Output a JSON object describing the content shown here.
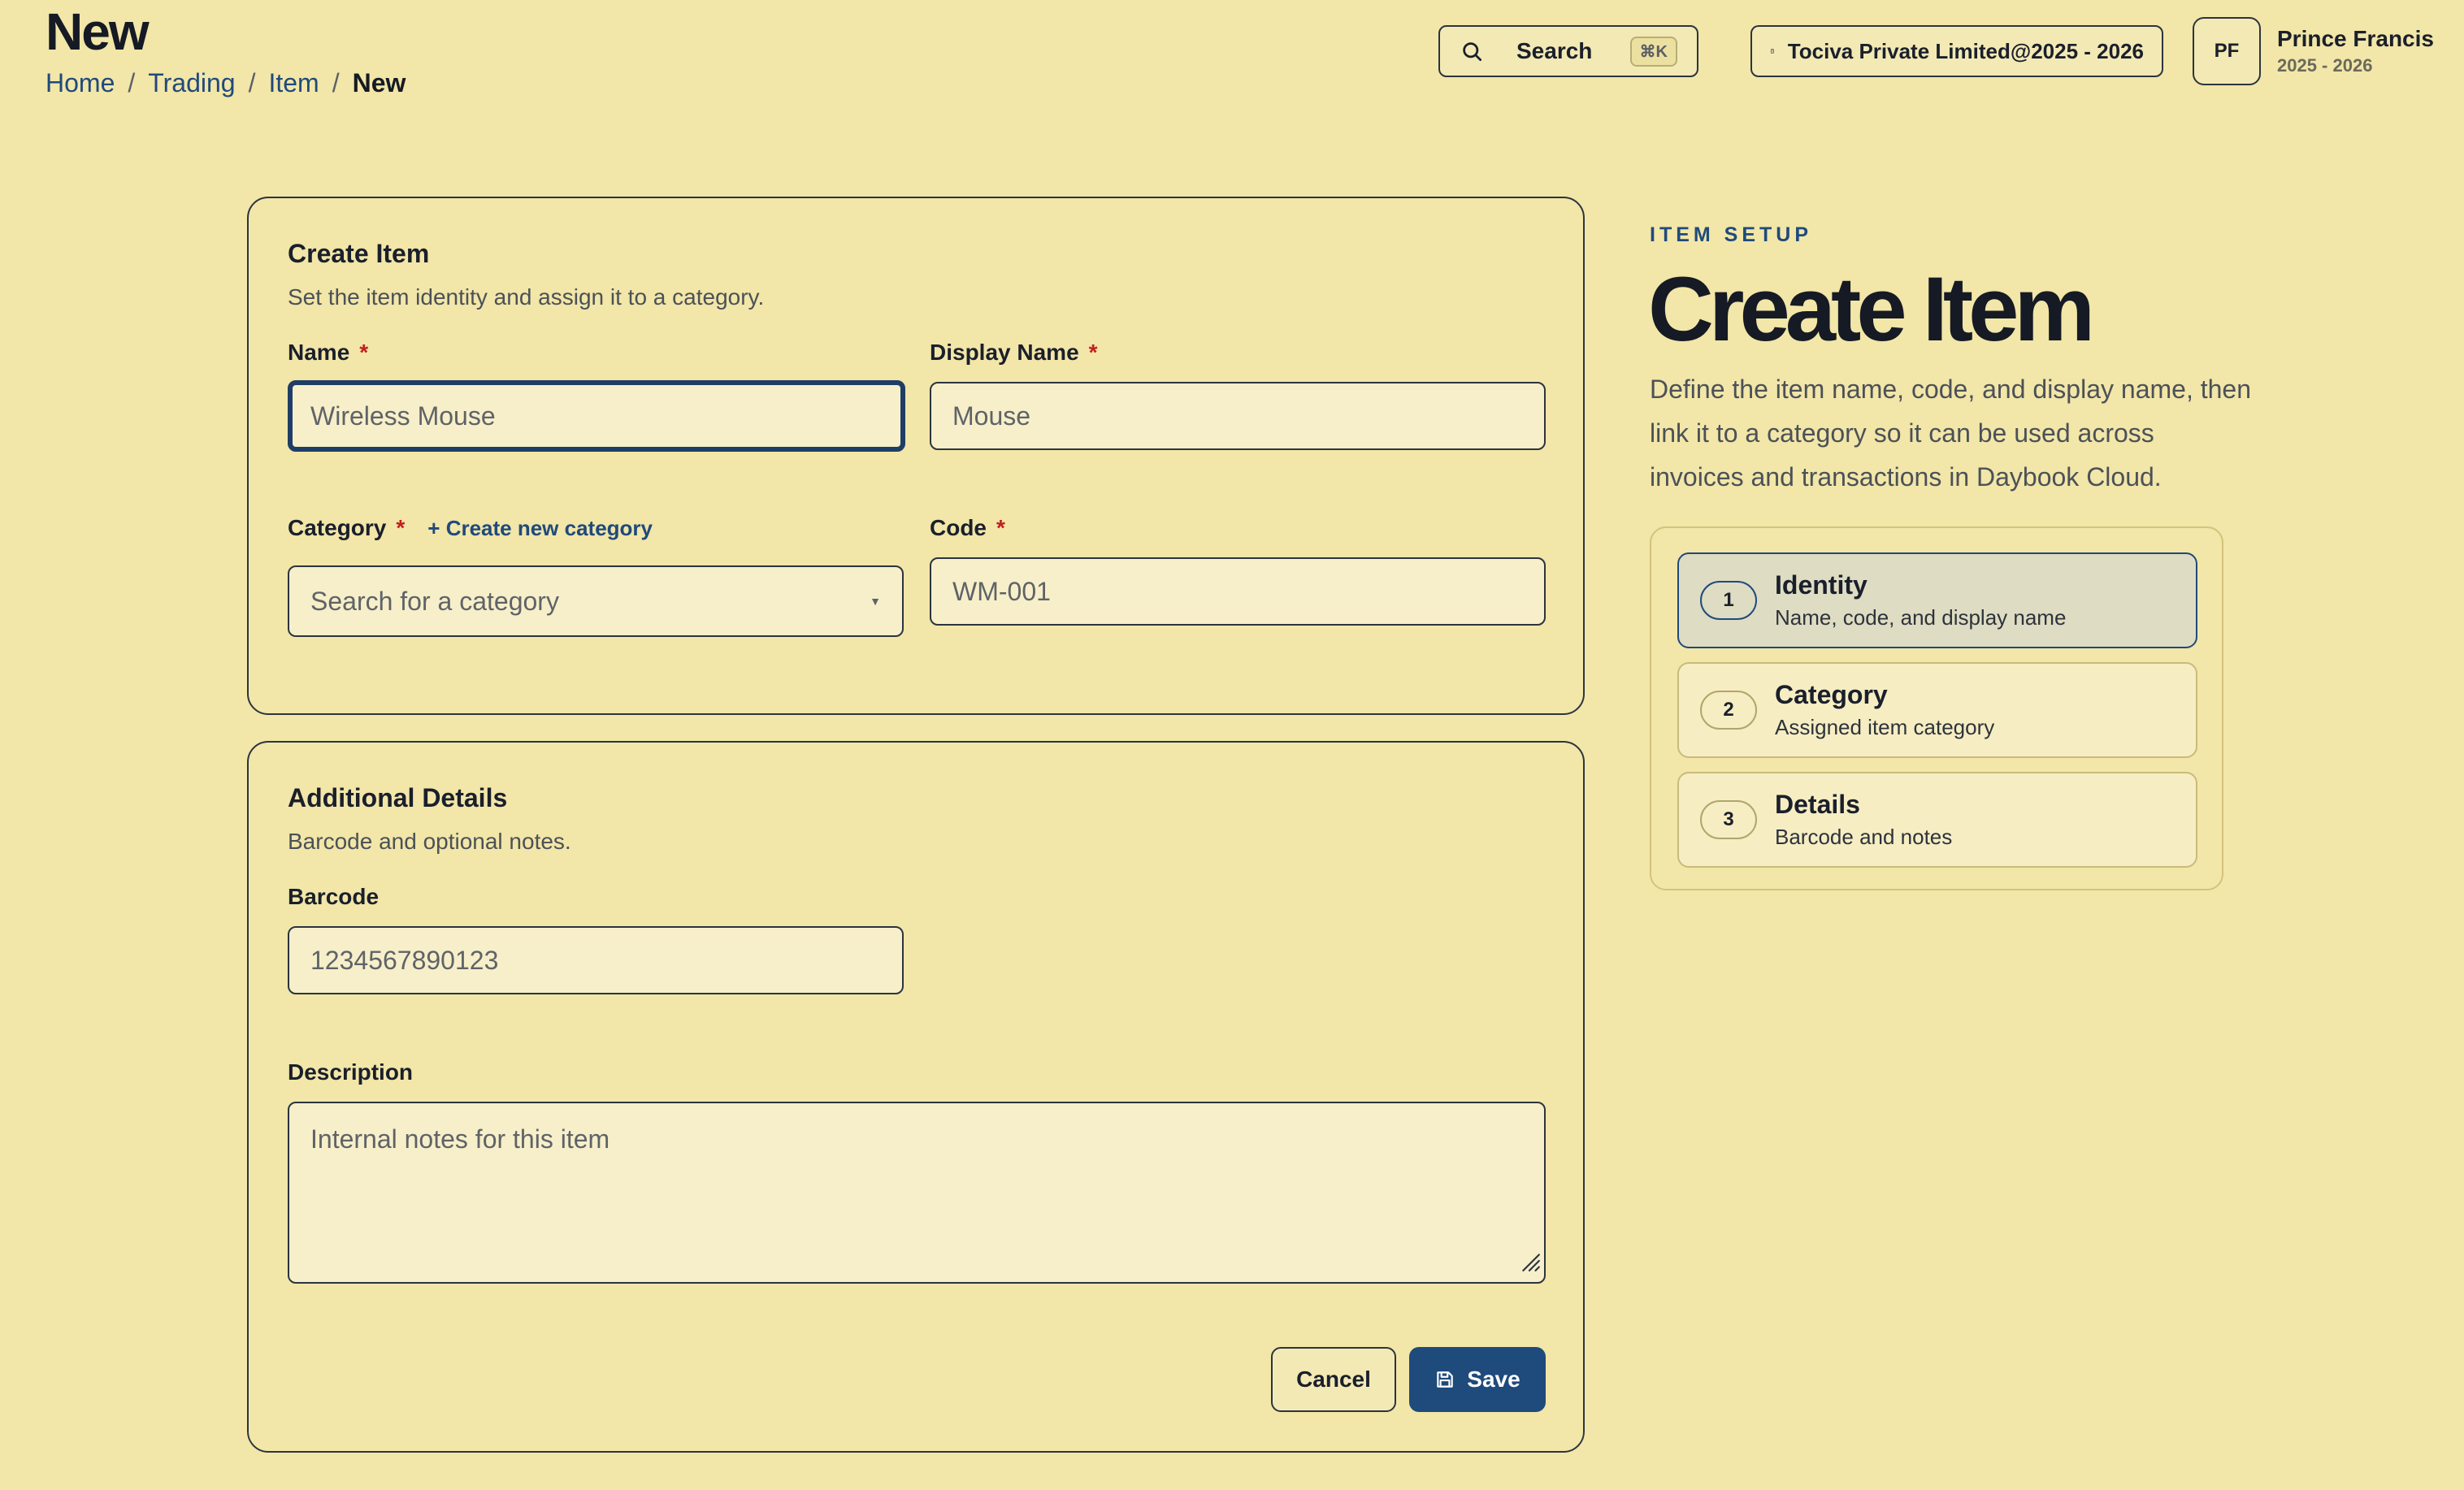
{
  "header": {
    "page_title": "New",
    "breadcrumb": [
      "Home",
      "Trading",
      "Item"
    ],
    "breadcrumb_current": "New",
    "search_label": "Search",
    "search_shortcut": "⌘K",
    "company": "Tociva Private Limited@2025 - 2026",
    "user_initials": "PF",
    "user_name": "Prince Francis",
    "user_period": "2025 - 2026"
  },
  "identity_card": {
    "title": "Create Item",
    "subtitle": "Set the item identity and assign it to a category.",
    "name_label": "Name",
    "name_placeholder": "Wireless Mouse",
    "display_name_label": "Display Name",
    "display_name_placeholder": "Mouse",
    "category_label": "Category",
    "create_category_link": "+ Create new category",
    "category_placeholder": "Search for a category",
    "code_label": "Code",
    "code_placeholder": "WM-001",
    "required_mark": "*"
  },
  "details_card": {
    "title": "Additional Details",
    "subtitle": "Barcode and optional notes.",
    "barcode_label": "Barcode",
    "barcode_placeholder": "1234567890123",
    "description_label": "Description",
    "description_placeholder": "Internal notes for this item",
    "cancel_label": "Cancel",
    "save_label": "Save"
  },
  "setup_panel": {
    "eyebrow": "ITEM SETUP",
    "title": "Create Item",
    "description": "Define the item name, code, and display name, then link it to a category so it can be used across invoices and transactions in Daybook Cloud.",
    "steps": [
      {
        "number": "1",
        "title": "Identity",
        "subtitle": "Name, code, and display name",
        "active": true
      },
      {
        "number": "2",
        "title": "Category",
        "subtitle": "Assigned item category",
        "active": false
      },
      {
        "number": "3",
        "title": "Details",
        "subtitle": "Barcode and notes",
        "active": false
      }
    ]
  },
  "colors": {
    "background": "#f2e6a8",
    "primary": "#1f4a7c",
    "required": "#c21f1f",
    "active_step": "#dedcc2"
  }
}
